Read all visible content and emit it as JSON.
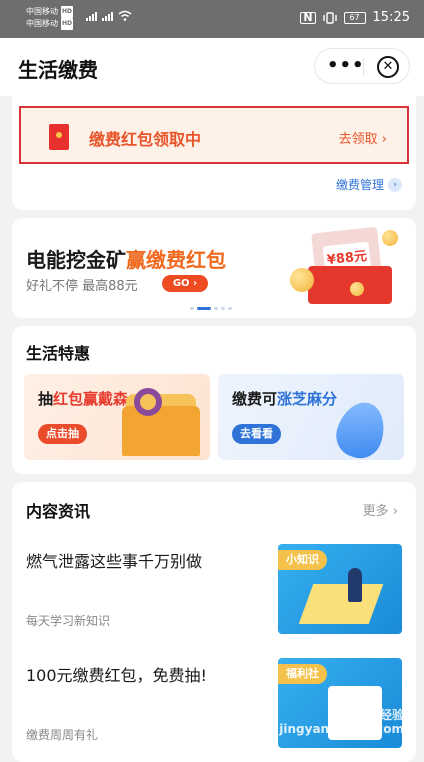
{
  "status_bar": {
    "carrier1": "中国移动",
    "carrier2": "中国移动",
    "hd": "HD",
    "net1": "4G",
    "net2": "4G",
    "nfc": "N",
    "battery": "67",
    "time": "15:25"
  },
  "header": {
    "title": "生活缴费",
    "more": "•••",
    "close": "✕"
  },
  "redpacket_banner": {
    "text": "缴费红包领取中",
    "link": "去领取 ›"
  },
  "management": {
    "label": "缴费管理",
    "arrow": "›"
  },
  "promo_banner": {
    "title_main": "电能挖金矿",
    "title_highlight": "赢缴费红包",
    "subtitle": "好礼不停 最高88元",
    "go_button": "GO ›",
    "art_amount": "¥88元"
  },
  "life_deals": {
    "title": "生活特惠",
    "items": [
      {
        "prefix": "抽",
        "highlight": "红包赢戴森",
        "button": "点击抽"
      },
      {
        "prefix": "缴费可",
        "highlight": "涨芝麻分",
        "button": "去看看"
      }
    ]
  },
  "news": {
    "title": "内容资讯",
    "more": "更多 ›",
    "items": [
      {
        "title": "燃气泄露这些事千万别做",
        "sub": "每天学习新知识",
        "tag": "小知识"
      },
      {
        "title": "100元缴费红包，免费抽!",
        "sub": "缴费周周有礼",
        "tag": "福利社"
      }
    ]
  },
  "watermark": "Baidu经验\njingyan.baidu.com",
  "colors": {
    "accent_orange": "#ef6a1f",
    "accent_red": "#e63b2e",
    "accent_blue": "#2f73d8",
    "highlight_border": "#d9333a"
  }
}
